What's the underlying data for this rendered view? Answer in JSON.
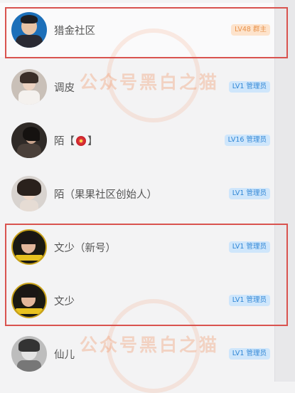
{
  "members": [
    {
      "name": "猎金社区",
      "badge": "LV48 群主",
      "badge_type": "owner",
      "avatar": "avatar-man-suit"
    },
    {
      "name": "调皮",
      "badge": "LV1 管理员",
      "badge_type": "admin",
      "avatar": "avatar-woman-white"
    },
    {
      "name_prefix": "陌【",
      "name_suffix": "】",
      "name_icon": "hibiscus-icon",
      "badge": "LV16 管理员",
      "badge_type": "admin",
      "avatar": "avatar-woman-dark"
    },
    {
      "name": "陌（果果社区创始人）",
      "badge": "LV1 管理员",
      "badge_type": "admin",
      "avatar": "avatar-woman-curls"
    },
    {
      "name": "文少（新号）",
      "badge": "LV1 管理员",
      "badge_type": "admin",
      "avatar": "avatar-man-gold"
    },
    {
      "name": "文少",
      "badge": "LV1 管理员",
      "badge_type": "admin",
      "avatar": "avatar-man-gold"
    },
    {
      "name": "仙儿",
      "badge": "LV1 管理员",
      "badge_type": "admin",
      "avatar": "avatar-grayscale"
    }
  ],
  "watermark": {
    "text": "公众号黑白之猫"
  },
  "colors": {
    "owner_badge_bg": "#fde3cc",
    "admin_badge_bg": "#cfe6fb",
    "highlight": "#d9534f"
  }
}
